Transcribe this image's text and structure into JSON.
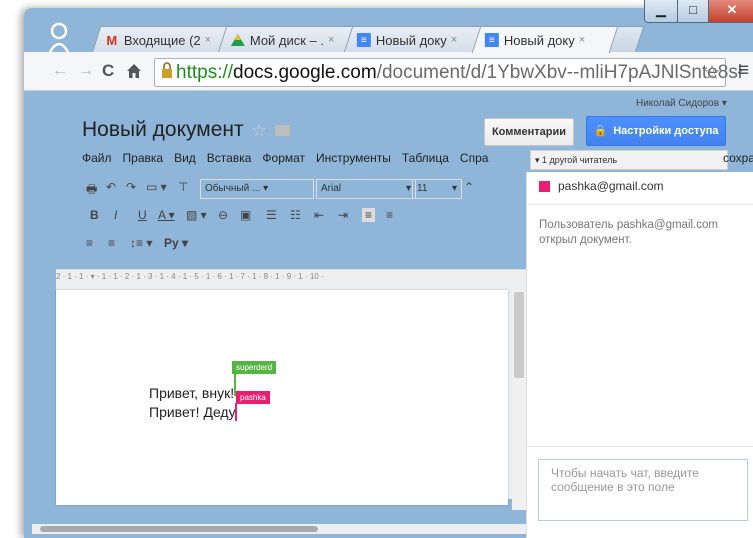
{
  "browser": {
    "tabs": [
      {
        "label": "Входящие (2",
        "icon": "gmail-icon",
        "color": "#d93025"
      },
      {
        "label": "Мой диск – .",
        "icon": "drive-icon",
        "color": "#1e9e4a"
      },
      {
        "label": "Новый доку",
        "icon": "docs-icon",
        "color": "#4285f4"
      },
      {
        "label": "Новый доку",
        "icon": "docs-icon",
        "color": "#4285f4",
        "active": true
      }
    ],
    "url": {
      "scheme": "https://",
      "host": "docs.google.com",
      "path": "/document/d/1YbwXbv--mliH7pAJNlSnte8sł"
    }
  },
  "doc": {
    "title": "Новый документ",
    "user": "Николай Сидоров ▾",
    "comments_label": "Комментарии",
    "share_label": "Настройки доступа",
    "menu": [
      "Файл",
      "Правка",
      "Вид",
      "Вставка",
      "Формат",
      "Инструменты",
      "Таблица",
      "Спра"
    ],
    "menu_tail": "сохра",
    "readers": "1 другой читатель",
    "toolbar": {
      "style": "Обычный ...",
      "font": "Arial",
      "size": "11",
      "ru_tool": "Ру"
    },
    "ruler": "2 · 1 · 1 · ▾ · 1 · 1 · 2 · 1 · 3 · 1 · 4 · 1 · 5 · 1 · 6 · 1 · 7 · 1 · 8 · 1 · 9 · 1 · 10 ·",
    "lines": [
      "Привет, внук!",
      "Привет! Деду"
    ],
    "cursors": [
      {
        "name": "superderd",
        "color": "#55b444"
      },
      {
        "name": "pashka",
        "color": "#e91e73"
      }
    ]
  },
  "chat": {
    "participant": "pashka@gmail.com",
    "participant_color": "#e91e73",
    "message": "Пользователь pashka@gmail.com открыл документ.",
    "input_placeholder": "Чтобы начать чат, введите сообщение в это поле"
  }
}
